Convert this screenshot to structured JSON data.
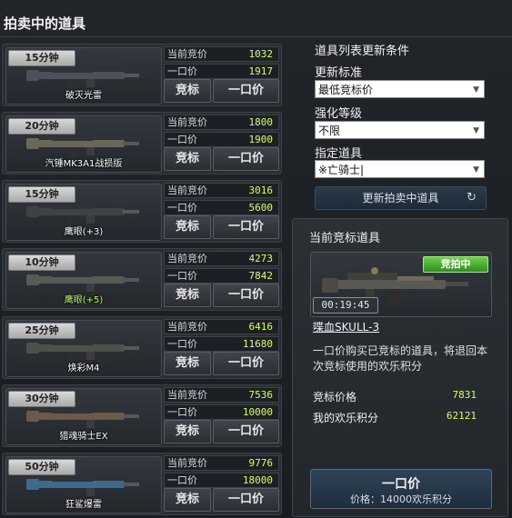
{
  "header": {
    "title": "拍卖中的道具"
  },
  "items": [
    {
      "timer": "15分钟",
      "name": "破灭光雷",
      "name_green": false,
      "current_bid_label": "当前竞价",
      "current_bid": "1032",
      "buyout_label": "一口价",
      "buyout": "1917",
      "bid_button": "竞标",
      "buy_button": "一口价"
    },
    {
      "timer": "20分钟",
      "name": "汽锤MK3A1战损版",
      "name_green": false,
      "current_bid_label": "当前竞价",
      "current_bid": "1800",
      "buyout_label": "一口价",
      "buyout": "1900",
      "bid_button": "竞标",
      "buy_button": "一口价"
    },
    {
      "timer": "15分钟",
      "name": "鹰眼(+3)",
      "name_green": false,
      "current_bid_label": "当前竞价",
      "current_bid": "3016",
      "buyout_label": "一口价",
      "buyout": "5600",
      "bid_button": "竞标",
      "buy_button": "一口价"
    },
    {
      "timer": "10分钟",
      "name": "鹰眼(+5)",
      "name_green": true,
      "current_bid_label": "当前竞价",
      "current_bid": "4273",
      "buyout_label": "一口价",
      "buyout": "7842",
      "bid_button": "竞标",
      "buy_button": "一口价"
    },
    {
      "timer": "25分钟",
      "name": "焕彩M4",
      "name_green": false,
      "current_bid_label": "当前竞价",
      "current_bid": "6416",
      "buyout_label": "一口价",
      "buyout": "11680",
      "bid_button": "竞标",
      "buy_button": "一口价"
    },
    {
      "timer": "30分钟",
      "name": "猎魂骑士EX",
      "name_green": false,
      "current_bid_label": "当前竞价",
      "current_bid": "7536",
      "buyout_label": "一口价",
      "buyout": "10000",
      "bid_button": "竞标",
      "buy_button": "一口价"
    },
    {
      "timer": "50分钟",
      "name": "狂鲨爆雷",
      "name_green": false,
      "current_bid_label": "当前竞价",
      "current_bid": "9776",
      "buyout_label": "一口价",
      "buyout": "18000",
      "bid_button": "竞标",
      "buy_button": "一口价"
    }
  ],
  "filter": {
    "heading": "道具列表更新条件",
    "sort_label": "更新标准",
    "sort_value": "最低竞标价",
    "enhance_label": "强化等级",
    "enhance_value": "不限",
    "item_label": "指定道具",
    "item_value": "※亡骑士|",
    "refresh_button": "更新拍卖中道具",
    "refresh_icon": "↻"
  },
  "current": {
    "heading": "当前竞标道具",
    "status": "竞拍中",
    "timer": "00:19:45",
    "item_name": "喋血SKULL-3",
    "description": "一口价购买已竞标的道具，将退回本次竞标使用的欢乐积分",
    "bid_price_label": "竞标价格",
    "bid_price": "7831",
    "points_label": "我的欢乐积分",
    "points": "62121",
    "buy_label": "一口价",
    "buy_price": "价格：14000欢乐积分"
  },
  "colors": {
    "value_green": "#d7ff5c",
    "status_green": "#4fbf2f",
    "panel": "#1c2024"
  }
}
